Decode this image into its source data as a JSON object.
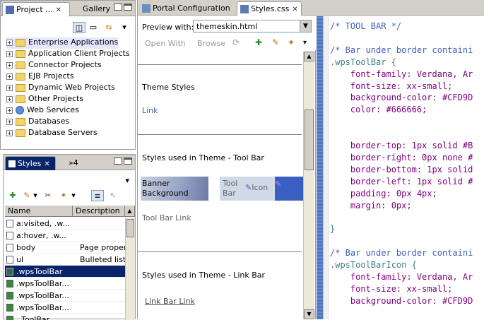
{
  "project_view": {
    "tabs": [
      {
        "label": "Project ..."
      },
      {
        "label": "Gallery"
      }
    ],
    "items": [
      {
        "label": "Enterprise Applications"
      },
      {
        "label": "Application Client Projects"
      },
      {
        "label": "Connector Projects"
      },
      {
        "label": "EJB Projects"
      },
      {
        "label": "Dynamic Web Projects"
      },
      {
        "label": "Other Projects"
      },
      {
        "label": "Web Services"
      },
      {
        "label": "Databases"
      },
      {
        "label": "Database Servers"
      }
    ]
  },
  "styles_view": {
    "tab_label": "Styles",
    "overflow_label": "»4",
    "columns": [
      "Name",
      "Description"
    ],
    "rows": [
      {
        "name": "a:visited, .w...",
        "desc": ""
      },
      {
        "name": "a:hover, .w...",
        "desc": ""
      },
      {
        "name": "body",
        "desc": "Page properti"
      },
      {
        "name": "ul",
        "desc": "Bulleted list"
      },
      {
        "name": ".wpsToolBar",
        "desc": ""
      },
      {
        "name": ".wpsToolBar...",
        "desc": ""
      },
      {
        "name": ".wpsToolBar...",
        "desc": ""
      },
      {
        "name": ".wpsToolBar...",
        "desc": ""
      },
      {
        "name": "..ToolBar...",
        "desc": ""
      }
    ]
  },
  "editor_tabs": [
    {
      "label": "Portal Configuration"
    },
    {
      "label": "Styles.css"
    }
  ],
  "preview": {
    "label": "Preview with:",
    "value": "themeskin.html",
    "open_with": "Open With",
    "browse": "Browse",
    "theme_styles": "Theme Styles",
    "link": "Link",
    "toolbar_heading": "Styles used in Theme - Tool Bar",
    "banner": "Banner Background",
    "tool_bar": "Tool Bar",
    "icon": "Icon",
    "tool_bar_link": "Tool Bar Link",
    "linkbar_heading": "Styles used in Theme - Link Bar",
    "link_bar_link": "Link Bar Link"
  },
  "css_source": [
    {
      "t": "cm",
      "s": "/* TOOL BAR */"
    },
    {
      "t": "",
      "s": ""
    },
    {
      "t": "cm",
      "s": "/* Bar under border containi"
    },
    {
      "t": "sel-c",
      "s": ".wpsToolBar {"
    },
    {
      "t": "prop",
      "s": "    font-family: Verdana, Ar"
    },
    {
      "t": "prop",
      "s": "    font-size: xx-small;"
    },
    {
      "t": "prop",
      "s": "    background-color: #CFD9D"
    },
    {
      "t": "prop",
      "s": "    color: #666666;"
    },
    {
      "t": "",
      "s": ""
    },
    {
      "t": "",
      "s": ""
    },
    {
      "t": "prop",
      "s": "    border-top: 1px solid #B"
    },
    {
      "t": "prop",
      "s": "    border-right: 0px none #"
    },
    {
      "t": "prop",
      "s": "    border-bottom: 1px solid"
    },
    {
      "t": "prop",
      "s": "    border-left: 1px solid #"
    },
    {
      "t": "prop",
      "s": "    padding: 0px 4px;"
    },
    {
      "t": "prop",
      "s": "    margin: 0px;"
    },
    {
      "t": "",
      "s": ""
    },
    {
      "t": "sel-c",
      "s": "}"
    },
    {
      "t": "",
      "s": ""
    },
    {
      "t": "cm",
      "s": "/* Bar under border containi"
    },
    {
      "t": "sel-c",
      "s": ".wpsToolBarIcon {"
    },
    {
      "t": "prop",
      "s": "    font-family: Verdana, Ar"
    },
    {
      "t": "prop",
      "s": "    font-size: xx-small;"
    },
    {
      "t": "prop",
      "s": "    background-color: #CFD9D"
    }
  ],
  "colors": {
    "selection": "#0a246a",
    "link": "#3f5f9f",
    "banner": "#6b7aa6",
    "code_comment": "#3f5fbf"
  }
}
